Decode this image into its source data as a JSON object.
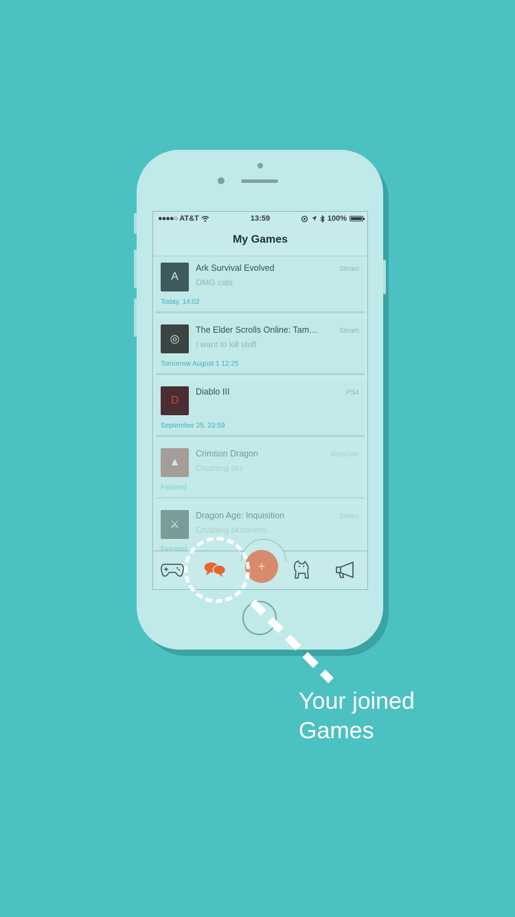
{
  "status_bar": {
    "carrier": "AT&T",
    "time": "13:59",
    "battery": "100%"
  },
  "nav": {
    "title": "My Games"
  },
  "games": [
    {
      "title": "Ark Survival Evolved",
      "subtitle": "OMG cats",
      "platform": "Steam",
      "time": "Today, 14:02",
      "thumb_color": "#3d5a5e",
      "thumb_icon": "A",
      "finished": false
    },
    {
      "title": "The Elder Scrolls Online: Tam…",
      "subtitle": "I want to kill stuff",
      "platform": "Steam",
      "time": "Tomorrow August 1 12:25",
      "thumb_color": "#3a4442",
      "thumb_icon": "◎",
      "finished": false
    },
    {
      "title": "Diablo III",
      "subtitle": "",
      "platform": "PS4",
      "time": "September 25, 23:59",
      "thumb_color": "#4a2e34",
      "thumb_icon": "D",
      "finished": false
    },
    {
      "title": "Crimson Dragon",
      "subtitle": "Crushing skz",
      "platform": "XboxOne",
      "time": "Finished",
      "thumb_color": "#8a5e56",
      "thumb_icon": "▲",
      "finished": true
    },
    {
      "title": "Dragon Age: Inquisition",
      "subtitle": "Crushing skznnxms",
      "platform": "Steam",
      "time": "Finished",
      "thumb_color": "#3f5a55",
      "thumb_icon": "⚔",
      "finished": true
    }
  ],
  "tabs": {
    "games": "gamepad-icon",
    "chats": "chat-bubbles-icon",
    "add_label": "+",
    "pets": "dog-icon",
    "announce": "megaphone-icon"
  },
  "callout": {
    "line1": "Your joined",
    "line2": "Games"
  },
  "colors": {
    "background": "#4bc1c2",
    "accent_orange": "#e8642c",
    "add_button": "#d78a6c",
    "time_text": "#3cb2c0"
  }
}
